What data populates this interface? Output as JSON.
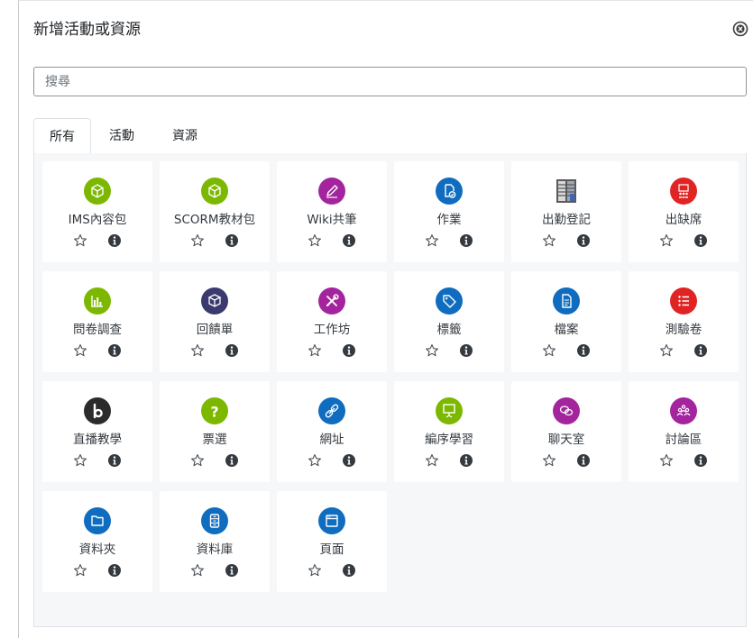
{
  "dialog": {
    "title": "新增活動或資源",
    "close_label": "close"
  },
  "search": {
    "placeholder": "搜尋",
    "value": ""
  },
  "tabs": [
    {
      "label": "所有",
      "active": true
    },
    {
      "label": "活動",
      "active": false
    },
    {
      "label": "資源",
      "active": false
    }
  ],
  "modules": [
    {
      "label": "IMS內容包",
      "icon": "package-icon",
      "color": "#7cb800"
    },
    {
      "label": "SCORM教材包",
      "icon": "package-icon",
      "color": "#7cb800"
    },
    {
      "label": "Wiki共筆",
      "icon": "pencil-icon",
      "color": "#a4249d"
    },
    {
      "label": "作業",
      "icon": "assignment-icon",
      "color": "#0f6cbf"
    },
    {
      "label": "出勤登記",
      "icon": "attendance-icon",
      "color": "#4a4a4a"
    },
    {
      "label": "出缺席",
      "icon": "attendance-group-icon",
      "color": "#e02424"
    },
    {
      "label": "問卷調查",
      "icon": "chart-icon",
      "color": "#7cb800"
    },
    {
      "label": "回饋單",
      "icon": "feedback-box-icon",
      "color": "#3a3a6e"
    },
    {
      "label": "工作坊",
      "icon": "tools-icon",
      "color": "#a4249d"
    },
    {
      "label": "標籤",
      "icon": "tag-icon",
      "color": "#0f6cbf"
    },
    {
      "label": "檔案",
      "icon": "file-icon",
      "color": "#0f6cbf"
    },
    {
      "label": "測驗卷",
      "icon": "list-icon",
      "color": "#e02424"
    },
    {
      "label": "直播教學",
      "icon": "bigbluebutton-icon",
      "color": "#2b2b2b"
    },
    {
      "label": "票選",
      "icon": "question-icon",
      "color": "#7cb800"
    },
    {
      "label": "網址",
      "icon": "link-icon",
      "color": "#0f6cbf"
    },
    {
      "label": "編序學習",
      "icon": "presentation-icon",
      "color": "#7cb800"
    },
    {
      "label": "聊天室",
      "icon": "chat-icon",
      "color": "#a4249d"
    },
    {
      "label": "討論區",
      "icon": "forum-icon",
      "color": "#a4249d"
    },
    {
      "label": "資料夾",
      "icon": "folder-icon",
      "color": "#0f6cbf"
    },
    {
      "label": "資料庫",
      "icon": "database-icon",
      "color": "#0f6cbf"
    },
    {
      "label": "頁面",
      "icon": "page-icon",
      "color": "#0f6cbf"
    }
  ]
}
